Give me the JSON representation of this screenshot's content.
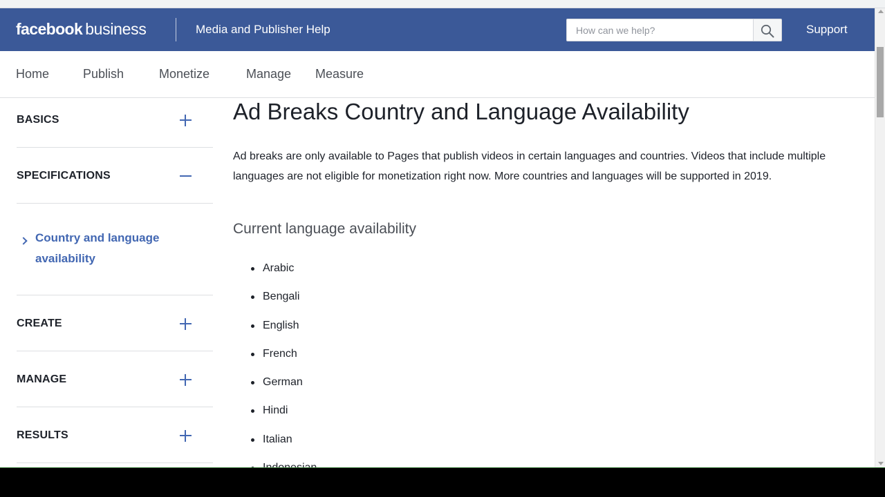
{
  "header": {
    "logo_brand": "facebook",
    "logo_suffix": "business",
    "site_title": "Media and Publisher Help",
    "search_placeholder": "How can we help?",
    "support_label": "Support",
    "bg_color": "#3b5998"
  },
  "nav": {
    "items": [
      "Home",
      "Publish",
      "Monetize",
      "Manage",
      "Measure"
    ]
  },
  "sidebar": {
    "sections": [
      {
        "label": "BASICS",
        "state": "collapsed"
      },
      {
        "label": "SPECIFICATIONS",
        "state": "expanded"
      },
      {
        "label": "CREATE",
        "state": "collapsed"
      },
      {
        "label": "MANAGE",
        "state": "collapsed"
      },
      {
        "label": "RESULTS",
        "state": "collapsed"
      }
    ],
    "active_link": "Country and language availability",
    "accent_color": "#4267b2"
  },
  "main": {
    "title": "Ad Breaks Country and Language Availability",
    "intro": "Ad breaks are only available to Pages that publish videos in certain languages and countries. Videos that include multiple languages are not eligible for monetization right now. More countries and languages will be supported in 2019.",
    "subheading": "Current language availability",
    "languages": [
      "Arabic",
      "Bengali",
      "English",
      "French",
      "German",
      "Hindi",
      "Italian",
      "Indonesian"
    ]
  },
  "icons": {
    "search": "search-icon",
    "expand": "plus-icon",
    "collapse": "minus-icon",
    "chevron": "chevron-right-icon"
  }
}
